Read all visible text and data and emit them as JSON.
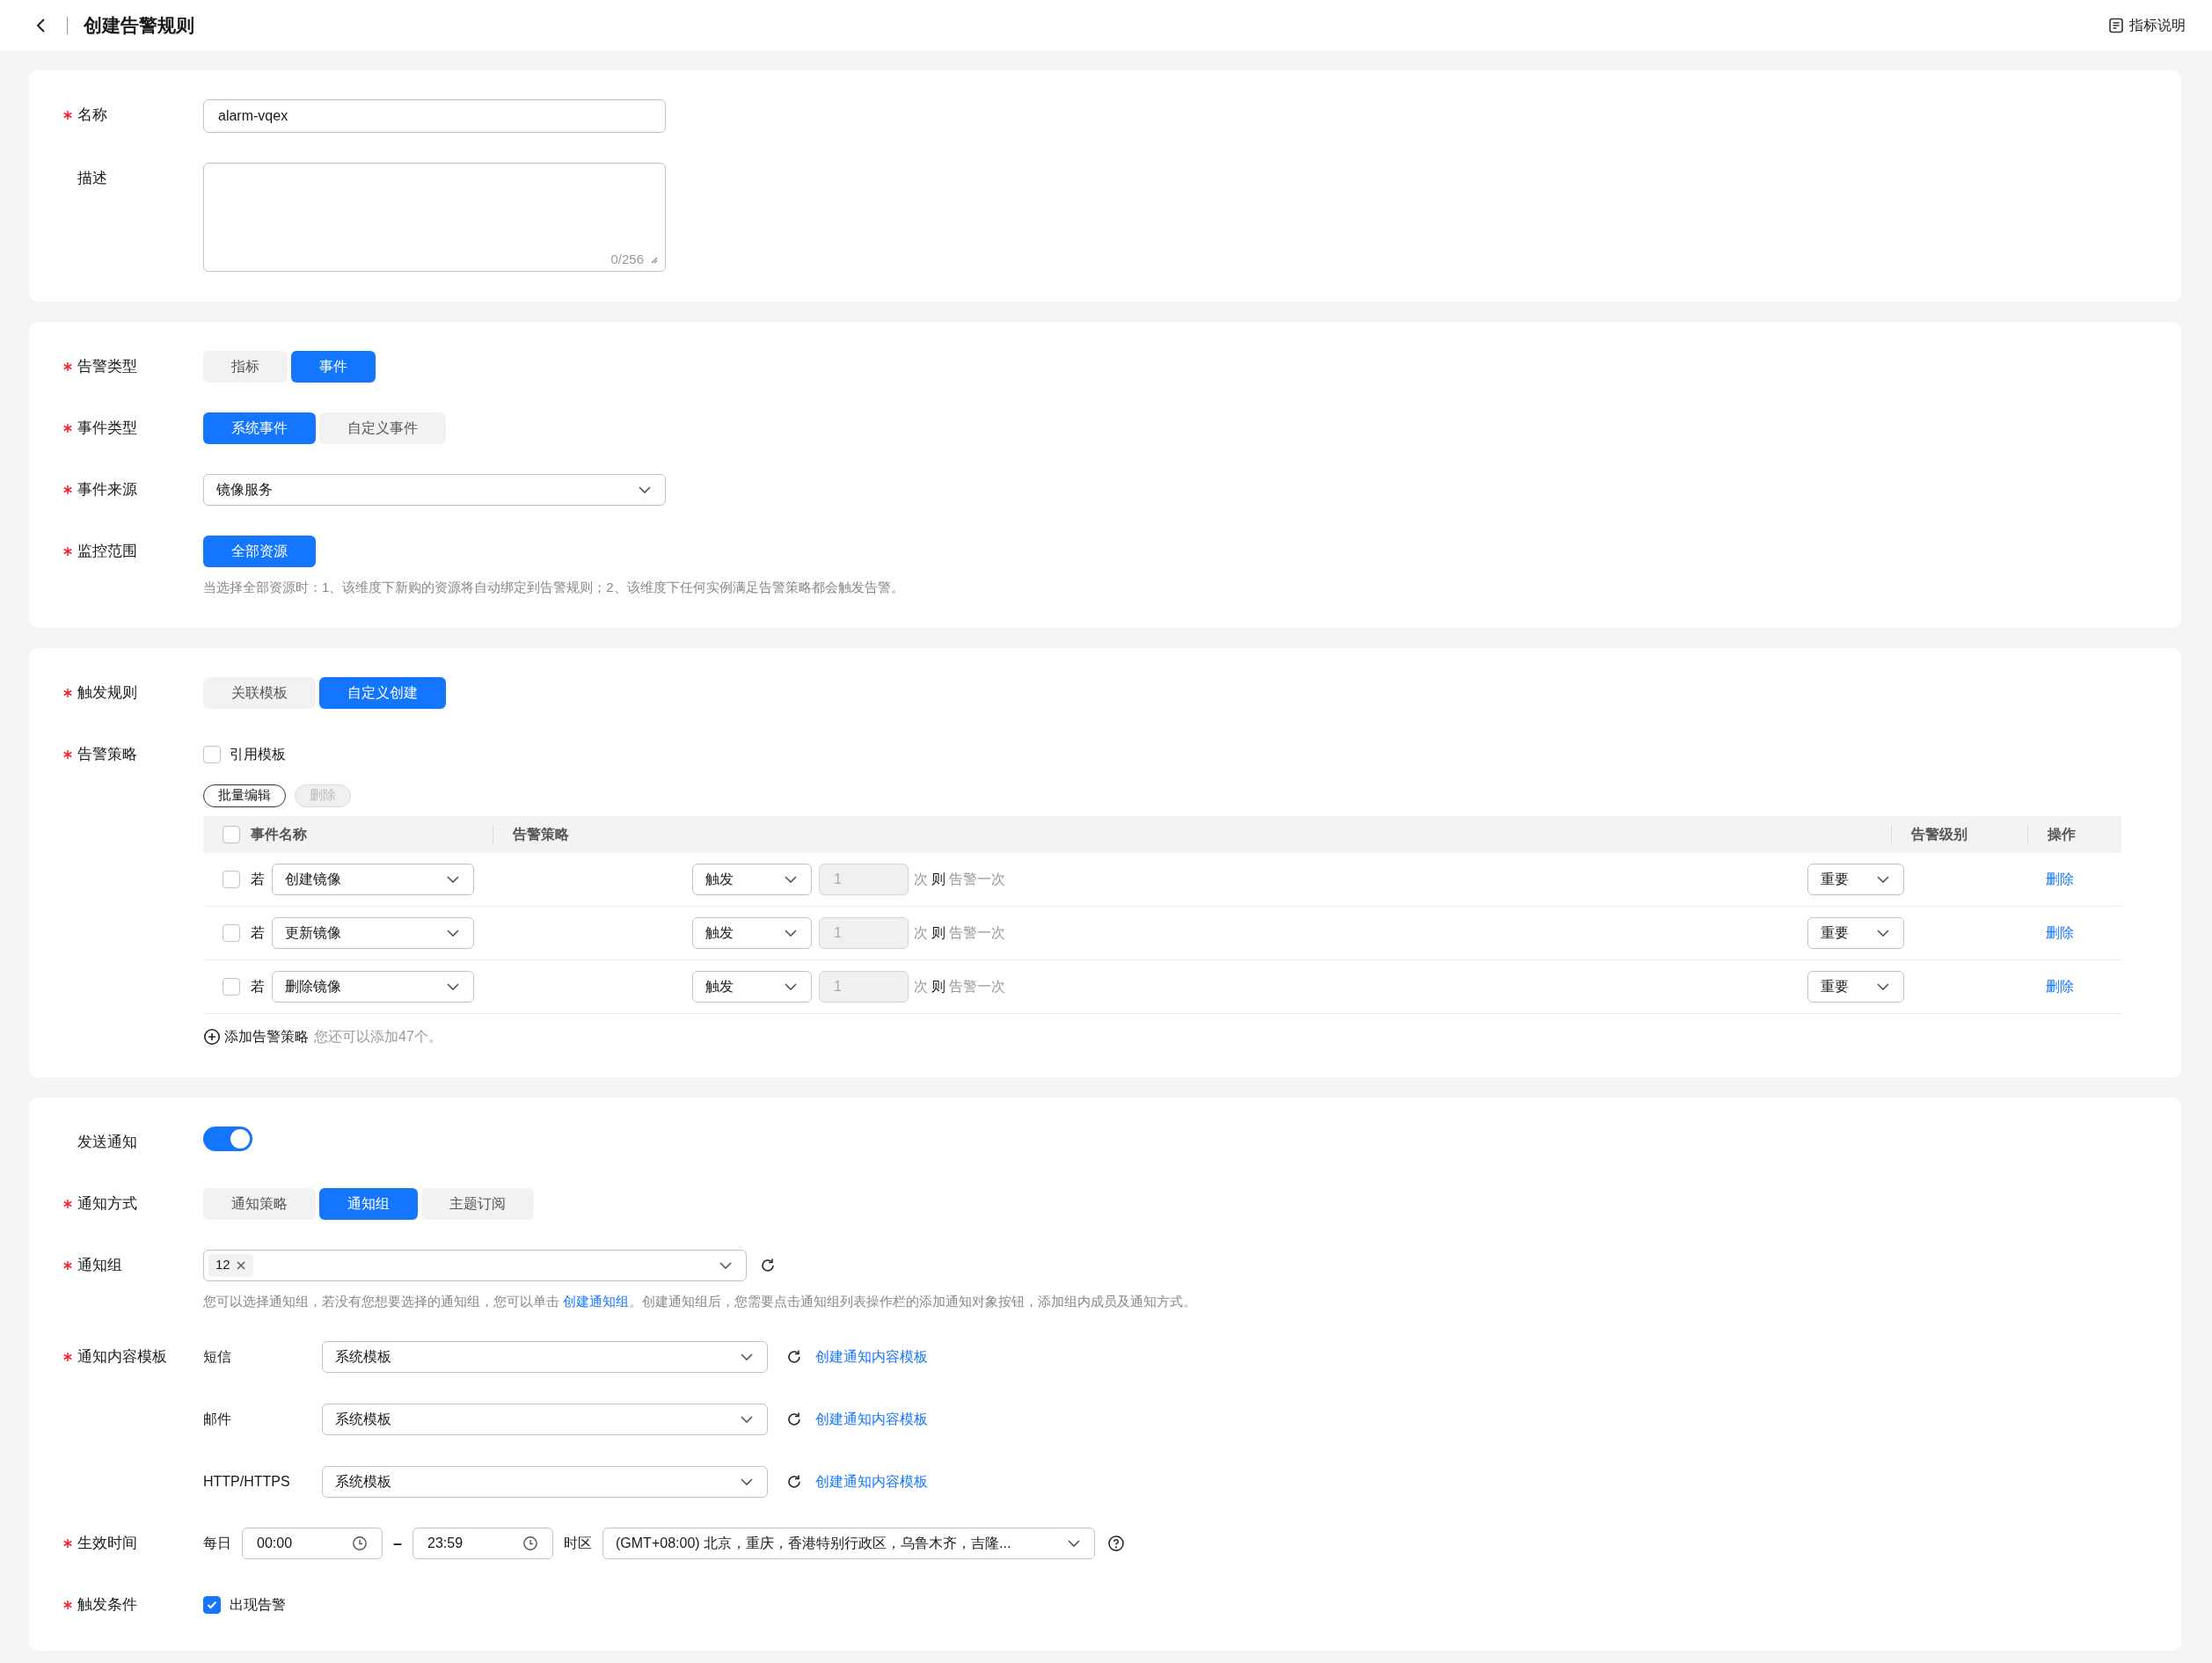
{
  "header": {
    "title": "创建告警规则",
    "help_link": "指标说明"
  },
  "cards": [
    {
      "fields": [
        {
          "kind": "input",
          "label": "名称",
          "required": true,
          "value": "alarm-vqex"
        },
        {
          "kind": "textarea",
          "label": "描述",
          "required": false,
          "counter": "0/256"
        }
      ]
    },
    {
      "fields": [
        {
          "kind": "segmented",
          "label": "告警类型",
          "required": true,
          "options": [
            {
              "label": "指标",
              "selected": false
            },
            {
              "label": "事件",
              "selected": true
            }
          ]
        },
        {
          "kind": "segmented",
          "label": "事件类型",
          "required": true,
          "options": [
            {
              "label": "系统事件",
              "selected": true
            },
            {
              "label": "自定义事件",
              "selected": false
            }
          ]
        },
        {
          "kind": "select",
          "label": "事件来源",
          "required": true,
          "value": "镜像服务"
        },
        {
          "kind": "segmented",
          "label": "监控范围",
          "required": true,
          "options": [
            {
              "label": "全部资源",
              "selected": true
            }
          ],
          "hint": "当选择全部资源时：1、该维度下新购的资源将自动绑定到告警规则；2、该维度下任何实例满足告警策略都会触发告警。"
        }
      ]
    },
    {
      "fields": [
        {
          "kind": "segmented",
          "label": "触发规则",
          "required": true,
          "options": [
            {
              "label": "关联模板",
              "selected": false
            },
            {
              "label": "自定义创建",
              "selected": true
            }
          ]
        },
        {
          "kind": "policy",
          "label": "告警策略",
          "required": true,
          "template_checkbox": {
            "label": "引用模板",
            "checked": false
          },
          "toolbar": [
            {
              "label": "批量编辑",
              "disabled": false
            },
            {
              "label": "删除",
              "disabled": true
            }
          ],
          "header_checked": false,
          "columns": [
            "事件名称",
            "告警策略",
            "告警级别",
            "操作"
          ],
          "rows": [
            {
              "checked": false,
              "prefix": "若",
              "event": "创建镜像",
              "condition": "触发",
              "count": "1",
              "count_disabled": true,
              "unit": "次",
              "then": "则",
              "action": "告警一次",
              "level": "重要",
              "delete": "删除"
            },
            {
              "checked": false,
              "prefix": "若",
              "event": "更新镜像",
              "condition": "触发",
              "count": "1",
              "count_disabled": true,
              "unit": "次",
              "then": "则",
              "action": "告警一次",
              "level": "重要",
              "delete": "删除"
            },
            {
              "checked": false,
              "prefix": "若",
              "event": "删除镜像",
              "condition": "触发",
              "count": "1",
              "count_disabled": true,
              "unit": "次",
              "then": "则",
              "action": "告警一次",
              "level": "重要",
              "delete": "删除"
            }
          ],
          "add_link": "添加告警策略",
          "add_note": "您还可以添加47个。"
        }
      ]
    },
    {
      "fields": [
        {
          "kind": "switch",
          "label": "发送通知",
          "required": false,
          "on": true
        },
        {
          "kind": "segmented",
          "label": "通知方式",
          "required": true,
          "options": [
            {
              "label": "通知策略",
              "selected": false
            },
            {
              "label": "通知组",
              "selected": true
            },
            {
              "label": "主题订阅",
              "selected": false
            }
          ]
        },
        {
          "kind": "tag_select",
          "label": "通知组",
          "required": true,
          "tags": [
            "12"
          ],
          "hint_before": "您可以选择通知组，若没有您想要选择的通知组，您可以单击 ",
          "hint_link": "创建通知组",
          "hint_after": "。创建通知组后，您需要点击通知组列表操作栏的添加通知对象按钮，添加组内成员及通知方式。"
        },
        {
          "kind": "templates",
          "label": "通知内容模板",
          "required": true,
          "channels": [
            {
              "name": "短信",
              "value": "系统模板",
              "link": "创建通知内容模板"
            },
            {
              "name": "邮件",
              "value": "系统模板",
              "link": "创建通知内容模板"
            },
            {
              "name": "HTTP/HTTPS",
              "value": "系统模板",
              "link": "创建通知内容模板"
            }
          ]
        },
        {
          "kind": "time_range",
          "label": "生效时间",
          "required": true,
          "prefix": "每日",
          "start": "00:00",
          "separator": "–",
          "end": "23:59",
          "timezone_label": "时区",
          "timezone": "(GMT+08:00) 北京，重庆，香港特别行政区，乌鲁木齐，吉隆..."
        },
        {
          "kind": "checkbox",
          "label": "触发条件",
          "required": true,
          "options": [
            {
              "label": "出现告警",
              "checked": true
            }
          ]
        }
      ]
    }
  ]
}
